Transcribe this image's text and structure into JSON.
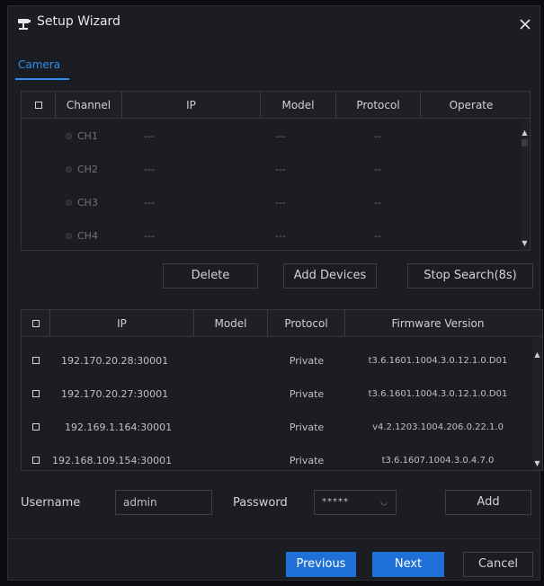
{
  "window": {
    "title": "Setup Wizard"
  },
  "tabs": [
    {
      "label": "Camera"
    }
  ],
  "channel_table": {
    "headers": {
      "channel": "Channel",
      "ip": "IP",
      "model": "Model",
      "protocol": "Protocol",
      "operate": "Operate"
    },
    "rows": [
      {
        "channel": "CH1",
        "ip": "---",
        "model": "---",
        "protocol": "--"
      },
      {
        "channel": "CH2",
        "ip": "---",
        "model": "---",
        "protocol": "--"
      },
      {
        "channel": "CH3",
        "ip": "---",
        "model": "---",
        "protocol": "--"
      },
      {
        "channel": "CH4",
        "ip": "---",
        "model": "---",
        "protocol": "--"
      }
    ]
  },
  "actions": {
    "delete": "Delete",
    "add_devices": "Add Devices",
    "stop_search": "Stop Search(8s)"
  },
  "device_table": {
    "headers": {
      "ip": "IP",
      "model": "Model",
      "protocol": "Protocol",
      "firmware": "Firmware Version"
    },
    "rows": [
      {
        "ip": "192.170.20.28:30001",
        "model": "",
        "protocol": "Private",
        "firmware": "t3.6.1601.1004.3.0.12.1.0.D01"
      },
      {
        "ip": "192.170.20.27:30001",
        "model": "",
        "protocol": "Private",
        "firmware": "t3.6.1601.1004.3.0.12.1.0.D01"
      },
      {
        "ip": "192.169.1.164:30001",
        "model": "",
        "protocol": "Private",
        "firmware": "v4.2.1203.1004.206.0.22.1.0"
      },
      {
        "ip": "192.168.109.154:30001",
        "model": "",
        "protocol": "Private",
        "firmware": "t3.6.1607.1004.3.0.4.7.0"
      }
    ]
  },
  "credentials": {
    "username_label": "Username",
    "username_value": "admin",
    "password_label": "Password",
    "password_value": "*****",
    "add": "Add"
  },
  "footer": {
    "previous": "Previous",
    "next": "Next",
    "cancel": "Cancel"
  },
  "colors": {
    "accent": "#2d8cf0",
    "primary_button": "#1e6fd6",
    "background": "#1c1d22"
  }
}
